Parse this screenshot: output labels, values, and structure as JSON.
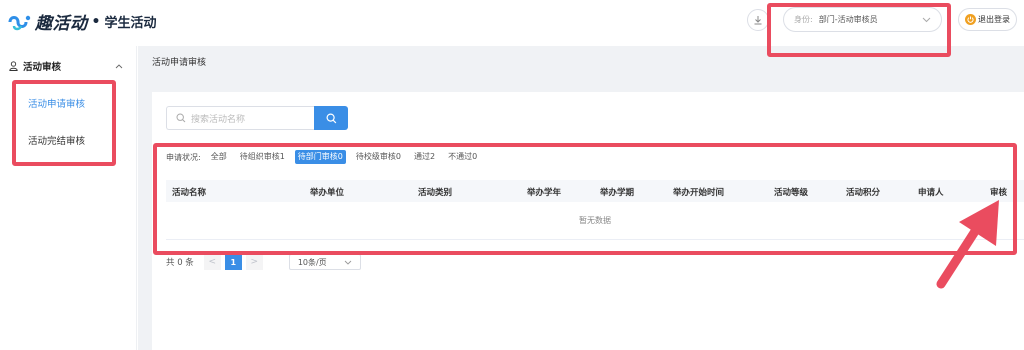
{
  "header": {
    "app_name": "趣活动",
    "separator": "•",
    "subtitle": "学生活动",
    "identity_label": "身份:",
    "identity_value": "部门-活动审核员",
    "logout_label": "退出登录"
  },
  "sidebar": {
    "group_label": "活动审核",
    "items": [
      {
        "label": "活动申请审核",
        "active": true
      },
      {
        "label": "活动完结审核",
        "active": false
      }
    ]
  },
  "main": {
    "breadcrumb": "活动申请审核",
    "search": {
      "placeholder": "搜索活动名称"
    },
    "filter": {
      "label": "申请状况:",
      "items": [
        {
          "label": "全部",
          "active": false
        },
        {
          "label": "待组织审核1",
          "active": false
        },
        {
          "label": "待部门审核0",
          "active": true
        },
        {
          "label": "待校级审核0",
          "active": false
        },
        {
          "label": "通过2",
          "active": false
        },
        {
          "label": "不通过0",
          "active": false
        }
      ]
    },
    "table": {
      "columns": [
        "活动名称",
        "举办单位",
        "活动类别",
        "举办学年",
        "举办学期",
        "举办开始时间",
        "活动等级",
        "活动积分",
        "申请人",
        "审核"
      ],
      "empty_text": "暂无数据"
    },
    "pagination": {
      "total_text": "共 0 条",
      "current_page": "1",
      "prev": "<",
      "next": ">",
      "page_size": "10条/页"
    }
  },
  "colors": {
    "accent": "#3a8ee6",
    "annotation": "#ea4c5f"
  }
}
